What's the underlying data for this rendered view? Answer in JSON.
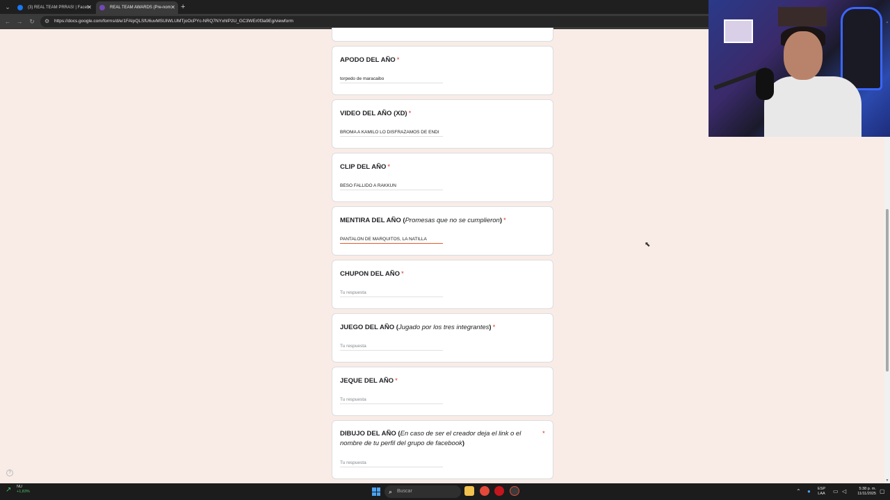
{
  "browser": {
    "tabs": [
      {
        "title": "(3) REAL TEAM PRRAS! | Faceb",
        "active": false,
        "favicon_color": "#1877f2"
      },
      {
        "title": "REAL TEAM AWARDS (Pre-nom",
        "active": true,
        "favicon_color": "#7248b9"
      }
    ],
    "new_tab": "+",
    "url": "https://docs.google.com/forms/d/e/1FAIpQLSfU6uvMSUIWLUMTjoOcPYc-NRQ7NYxhIP2U_GC3WEr0f3a9Eg/viewform"
  },
  "form": {
    "questions": [
      {
        "title": "APODO DEL AÑO",
        "answer": "torpedo de maracaibo",
        "placeholder": false
      },
      {
        "title": "VIDEO DEL AÑO (XD)",
        "answer": "BROMA A KAMILO LO DISFRAZAMOS DE ENDI",
        "placeholder": false
      },
      {
        "title": "CLIP DEL AÑO",
        "answer": "BESO FALLIDO A RAKKUN",
        "placeholder": false
      },
      {
        "title": "MENTIRA DEL AÑO (",
        "subtitle": "Promesas que no se cumplieron",
        "close": ")",
        "answer": "PANTALON DE MARQUITOS, LA NATILLA",
        "placeholder": false,
        "focused": true
      },
      {
        "title": "CHUPON DEL AÑO",
        "answer": "Tu respuesta",
        "placeholder": true
      },
      {
        "title": "JUEGO DEL AÑO (",
        "subtitle": "Jugado por los tres integrantes",
        "close": ")",
        "answer": "Tu respuesta",
        "placeholder": true
      },
      {
        "title": "JEQUE DEL AÑO",
        "answer": "Tu respuesta",
        "placeholder": true
      },
      {
        "title": "DIBUJO DEL AÑO (",
        "subtitle": "En caso de ser el creador deja el link o el nombre de tu perfil del grupo de facebook",
        "close": ")",
        "answer": "Tu respuesta",
        "placeholder": true
      }
    ],
    "required_mark": "*"
  },
  "taskbar": {
    "stock_name": "NU",
    "stock_change": "+1,83%",
    "search_placeholder": "Buscar",
    "lang_top": "ESP",
    "lang_bottom": "LAA",
    "time": "5:38 p. m.",
    "date": "11/11/2025"
  },
  "colors": {
    "page_bg": "#f9ece6",
    "required": "#d93025",
    "focus_underline": "#e35b2b"
  }
}
